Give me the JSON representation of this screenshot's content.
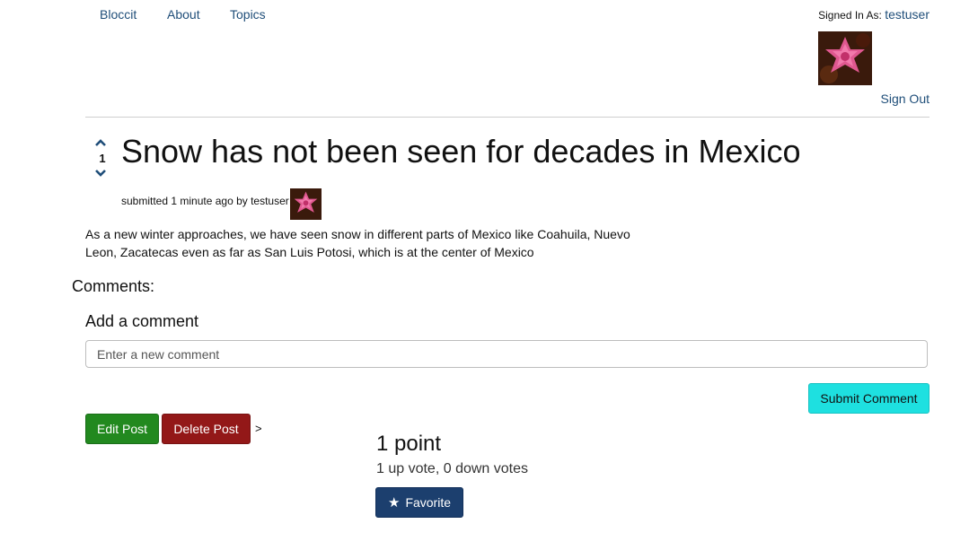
{
  "nav": {
    "items": [
      {
        "label": "Bloccit"
      },
      {
        "label": "About"
      },
      {
        "label": "Topics"
      }
    ]
  },
  "user": {
    "signed_in_label": "Signed In As:",
    "username": "testuser",
    "sign_out": "Sign Out"
  },
  "post": {
    "upvote_icon": "chevron-up-icon",
    "downvote_icon": "chevron-down-icon",
    "vote_count": "1",
    "title": "Snow has not been seen for decades in Mexico",
    "submitted": "submitted 1 minute ago by testuser",
    "body": "As a new winter approaches, we have seen snow in different parts of Mexico like Coahuila, Nuevo Leon, Zacatecas even as far as San Luis Potosi, which is at the center of Mexico"
  },
  "comments": {
    "heading": "Comments:",
    "add_heading": "Add a comment",
    "placeholder": "Enter a new comment",
    "submit_label": "Submit Comment"
  },
  "actions": {
    "edit_label": "Edit Post",
    "delete_label": "Delete Post",
    "separator": ">"
  },
  "stats": {
    "points": "1 point",
    "votes": "1 up vote, 0 down votes",
    "favorite_label": "Favorite",
    "favorite_icon": "star-icon"
  },
  "colors": {
    "link": "#1f4e79",
    "submit": "#1ee0e0",
    "edit": "#22891f",
    "delete": "#931818",
    "favorite": "#1c3f6e"
  }
}
